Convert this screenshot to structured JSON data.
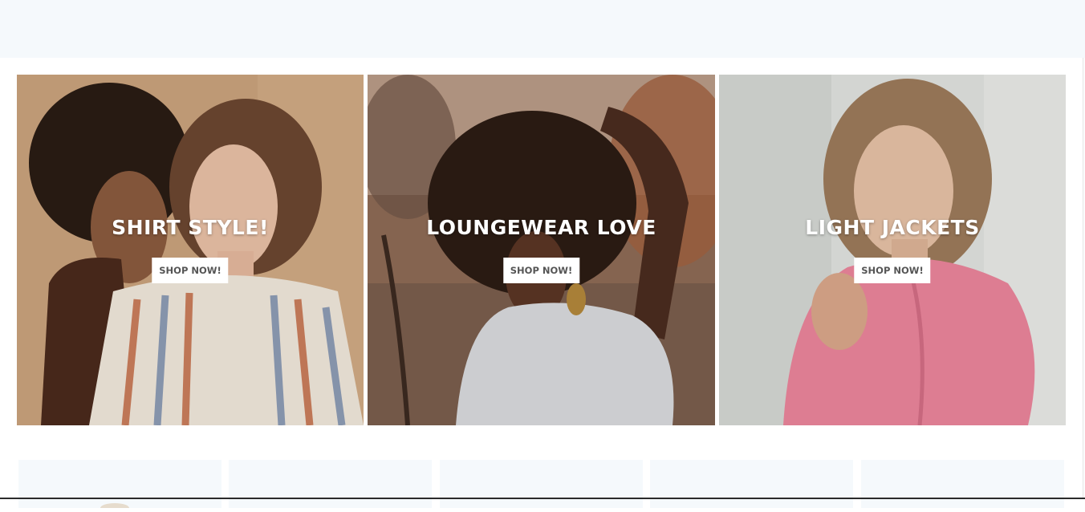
{
  "promo_tiles": [
    {
      "title": "SHIRT STYLE!",
      "button_label": "SHOP NOW!"
    },
    {
      "title": "LOUNGEWEAR LOVE",
      "button_label": "SHOP NOW!"
    },
    {
      "title": "LIGHT JACKETS",
      "button_label": "SHOP NOW!"
    }
  ],
  "product_cards": [
    {
      "name": ""
    },
    {
      "name": ""
    },
    {
      "name": ""
    },
    {
      "name": ""
    },
    {
      "name": ""
    }
  ],
  "colors": {
    "band_background": "#f5f9fc",
    "button_background": "#ffffff",
    "button_text": "#555555",
    "title_text": "#ffffff"
  }
}
